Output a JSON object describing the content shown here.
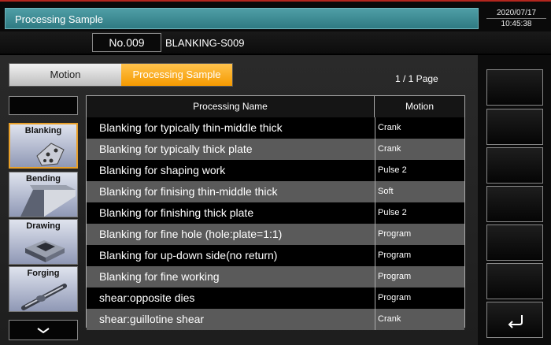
{
  "header": {
    "title": "Processing Sample",
    "date": "2020/07/17",
    "time": "10:45:38"
  },
  "program": {
    "number": "No.009",
    "name": "BLANKING-S009"
  },
  "tabs": [
    {
      "label": "Motion",
      "active": false
    },
    {
      "label": "Processing Sample",
      "active": true
    }
  ],
  "page_indicator": "1 / 1 Page",
  "categories": [
    {
      "label": "Blanking",
      "selected": true
    },
    {
      "label": "Bending",
      "selected": false
    },
    {
      "label": "Drawing",
      "selected": false
    },
    {
      "label": "Forging",
      "selected": false
    }
  ],
  "table": {
    "headers": {
      "name": "Processing Name",
      "motion": "Motion"
    },
    "rows": [
      {
        "name": "Blanking for typically thin-middle thick",
        "motion": "Crank"
      },
      {
        "name": "Blanking for typically thick plate",
        "motion": "Crank"
      },
      {
        "name": "Blanking for shaping work",
        "motion": "Pulse 2"
      },
      {
        "name": "Blanking for finising thin-middle thick",
        "motion": "Soft"
      },
      {
        "name": "Blanking for finishing thick plate",
        "motion": "Pulse 2"
      },
      {
        "name": "Blanking for fine hole (hole:plate=1:1)",
        "motion": "Program"
      },
      {
        "name": "Blanking for up-down side(no return)",
        "motion": "Program"
      },
      {
        "name": "Blanking for fine working",
        "motion": "Program"
      },
      {
        "name": "shear:opposite dies",
        "motion": "Program"
      },
      {
        "name": "shear:guillotine shear",
        "motion": "Crank"
      }
    ]
  },
  "function_keys": {
    "count": 7,
    "return_icon": "return-arrow-icon"
  },
  "colors": {
    "title_bar": "#2f7a82",
    "active_tab": "#f59a00",
    "selected_category_border": "#e8a02a",
    "alert_line": "#b3261e"
  }
}
